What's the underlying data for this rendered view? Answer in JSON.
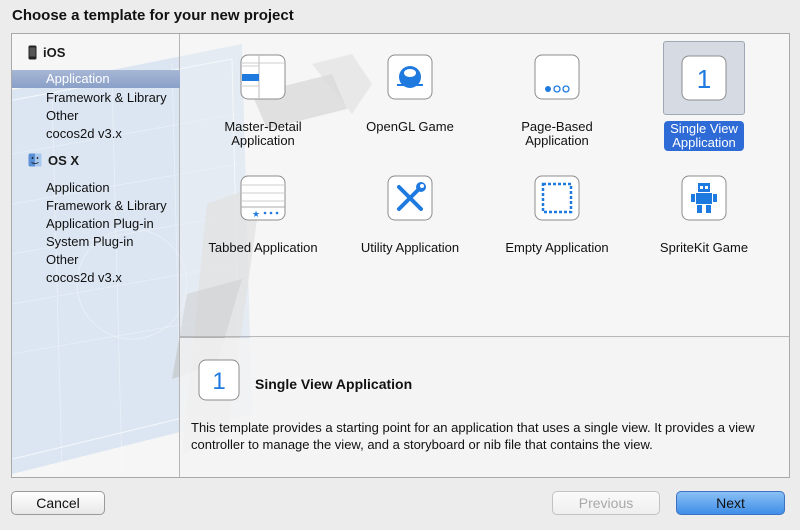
{
  "window": {
    "title": "Choose a template for your new project"
  },
  "sidebar": {
    "groups": [
      {
        "name": "iOS",
        "icon": "iphone-icon",
        "items": [
          "Application",
          "Framework & Library",
          "Other",
          "cocos2d v3.x"
        ]
      },
      {
        "name": "OS X",
        "icon": "mac-finder-icon",
        "items": [
          "Application",
          "Framework & Library",
          "Application Plug-in",
          "System Plug-in",
          "Other",
          "cocos2d v3.x"
        ]
      }
    ],
    "selected": "iOS / Application"
  },
  "templates": [
    {
      "label": "Master-Detail\nApplication",
      "icon": "master-detail-icon"
    },
    {
      "label": "OpenGL Game",
      "icon": "opengl-icon"
    },
    {
      "label": "Page-Based\nApplication",
      "icon": "page-based-icon"
    },
    {
      "label": "Single View\nApplication",
      "icon": "single-view-icon",
      "selected": true
    },
    {
      "label": "Tabbed Application",
      "icon": "tabbed-icon"
    },
    {
      "label": "Utility Application",
      "icon": "utility-tools-icon"
    },
    {
      "label": "Empty Application",
      "icon": "empty-app-icon"
    },
    {
      "label": "SpriteKit Game",
      "icon": "spritekit-robot-icon"
    }
  ],
  "description": {
    "icon_text": "1",
    "title": "Single View Application",
    "text": "This template provides a starting point for an application that uses a single view. It provides a view controller to manage the view, and a storyboard or nib file that contains the view."
  },
  "buttons": {
    "cancel": "Cancel",
    "previous": "Previous",
    "next": "Next"
  },
  "colors": {
    "accent": "#2f6bd6",
    "sidebar_selection": "#97aacd",
    "icon_blue": "#1f7ae0"
  }
}
